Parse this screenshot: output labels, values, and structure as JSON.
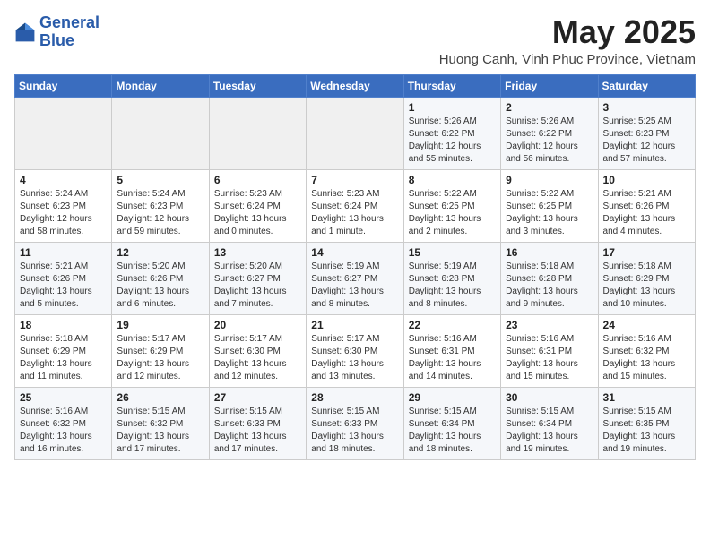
{
  "header": {
    "logo_line1": "General",
    "logo_line2": "Blue",
    "month_year": "May 2025",
    "location": "Huong Canh, Vinh Phuc Province, Vietnam"
  },
  "days_of_week": [
    "Sunday",
    "Monday",
    "Tuesday",
    "Wednesday",
    "Thursday",
    "Friday",
    "Saturday"
  ],
  "weeks": [
    [
      {
        "day": "",
        "info": ""
      },
      {
        "day": "",
        "info": ""
      },
      {
        "day": "",
        "info": ""
      },
      {
        "day": "",
        "info": ""
      },
      {
        "day": "1",
        "info": "Sunrise: 5:26 AM\nSunset: 6:22 PM\nDaylight: 12 hours\nand 55 minutes."
      },
      {
        "day": "2",
        "info": "Sunrise: 5:26 AM\nSunset: 6:22 PM\nDaylight: 12 hours\nand 56 minutes."
      },
      {
        "day": "3",
        "info": "Sunrise: 5:25 AM\nSunset: 6:23 PM\nDaylight: 12 hours\nand 57 minutes."
      }
    ],
    [
      {
        "day": "4",
        "info": "Sunrise: 5:24 AM\nSunset: 6:23 PM\nDaylight: 12 hours\nand 58 minutes."
      },
      {
        "day": "5",
        "info": "Sunrise: 5:24 AM\nSunset: 6:23 PM\nDaylight: 12 hours\nand 59 minutes."
      },
      {
        "day": "6",
        "info": "Sunrise: 5:23 AM\nSunset: 6:24 PM\nDaylight: 13 hours\nand 0 minutes."
      },
      {
        "day": "7",
        "info": "Sunrise: 5:23 AM\nSunset: 6:24 PM\nDaylight: 13 hours\nand 1 minute."
      },
      {
        "day": "8",
        "info": "Sunrise: 5:22 AM\nSunset: 6:25 PM\nDaylight: 13 hours\nand 2 minutes."
      },
      {
        "day": "9",
        "info": "Sunrise: 5:22 AM\nSunset: 6:25 PM\nDaylight: 13 hours\nand 3 minutes."
      },
      {
        "day": "10",
        "info": "Sunrise: 5:21 AM\nSunset: 6:26 PM\nDaylight: 13 hours\nand 4 minutes."
      }
    ],
    [
      {
        "day": "11",
        "info": "Sunrise: 5:21 AM\nSunset: 6:26 PM\nDaylight: 13 hours\nand 5 minutes."
      },
      {
        "day": "12",
        "info": "Sunrise: 5:20 AM\nSunset: 6:26 PM\nDaylight: 13 hours\nand 6 minutes."
      },
      {
        "day": "13",
        "info": "Sunrise: 5:20 AM\nSunset: 6:27 PM\nDaylight: 13 hours\nand 7 minutes."
      },
      {
        "day": "14",
        "info": "Sunrise: 5:19 AM\nSunset: 6:27 PM\nDaylight: 13 hours\nand 8 minutes."
      },
      {
        "day": "15",
        "info": "Sunrise: 5:19 AM\nSunset: 6:28 PM\nDaylight: 13 hours\nand 8 minutes."
      },
      {
        "day": "16",
        "info": "Sunrise: 5:18 AM\nSunset: 6:28 PM\nDaylight: 13 hours\nand 9 minutes."
      },
      {
        "day": "17",
        "info": "Sunrise: 5:18 AM\nSunset: 6:29 PM\nDaylight: 13 hours\nand 10 minutes."
      }
    ],
    [
      {
        "day": "18",
        "info": "Sunrise: 5:18 AM\nSunset: 6:29 PM\nDaylight: 13 hours\nand 11 minutes."
      },
      {
        "day": "19",
        "info": "Sunrise: 5:17 AM\nSunset: 6:29 PM\nDaylight: 13 hours\nand 12 minutes."
      },
      {
        "day": "20",
        "info": "Sunrise: 5:17 AM\nSunset: 6:30 PM\nDaylight: 13 hours\nand 12 minutes."
      },
      {
        "day": "21",
        "info": "Sunrise: 5:17 AM\nSunset: 6:30 PM\nDaylight: 13 hours\nand 13 minutes."
      },
      {
        "day": "22",
        "info": "Sunrise: 5:16 AM\nSunset: 6:31 PM\nDaylight: 13 hours\nand 14 minutes."
      },
      {
        "day": "23",
        "info": "Sunrise: 5:16 AM\nSunset: 6:31 PM\nDaylight: 13 hours\nand 15 minutes."
      },
      {
        "day": "24",
        "info": "Sunrise: 5:16 AM\nSunset: 6:32 PM\nDaylight: 13 hours\nand 15 minutes."
      }
    ],
    [
      {
        "day": "25",
        "info": "Sunrise: 5:16 AM\nSunset: 6:32 PM\nDaylight: 13 hours\nand 16 minutes."
      },
      {
        "day": "26",
        "info": "Sunrise: 5:15 AM\nSunset: 6:32 PM\nDaylight: 13 hours\nand 17 minutes."
      },
      {
        "day": "27",
        "info": "Sunrise: 5:15 AM\nSunset: 6:33 PM\nDaylight: 13 hours\nand 17 minutes."
      },
      {
        "day": "28",
        "info": "Sunrise: 5:15 AM\nSunset: 6:33 PM\nDaylight: 13 hours\nand 18 minutes."
      },
      {
        "day": "29",
        "info": "Sunrise: 5:15 AM\nSunset: 6:34 PM\nDaylight: 13 hours\nand 18 minutes."
      },
      {
        "day": "30",
        "info": "Sunrise: 5:15 AM\nSunset: 6:34 PM\nDaylight: 13 hours\nand 19 minutes."
      },
      {
        "day": "31",
        "info": "Sunrise: 5:15 AM\nSunset: 6:35 PM\nDaylight: 13 hours\nand 19 minutes."
      }
    ]
  ]
}
